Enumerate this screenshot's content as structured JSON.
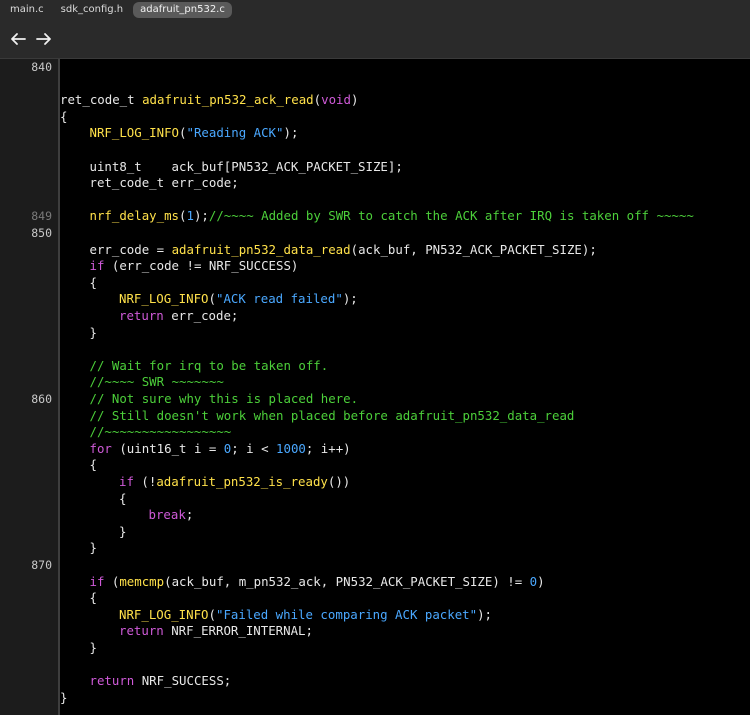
{
  "tabs": [
    {
      "label": "main.c",
      "active": false
    },
    {
      "label": "sdk_config.h",
      "active": false
    },
    {
      "label": "adafruit_pn532.c",
      "active": true
    }
  ],
  "nav": {
    "back_icon": "arrow-left-icon",
    "forward_icon": "arrow-right-icon"
  },
  "line_numbers": [
    {
      "text": "840",
      "row": 0,
      "style": "major"
    },
    {
      "text": "849",
      "row": 9,
      "style": "minor"
    },
    {
      "text": "850",
      "row": 10,
      "style": "major"
    },
    {
      "text": "860",
      "row": 20,
      "style": "major"
    },
    {
      "text": "870",
      "row": 30,
      "style": "major"
    }
  ],
  "colors": {
    "plain": "#e8e8e8",
    "keyword": "#cf5ad8",
    "function": "#ffe14a",
    "string": "#4aa8ff",
    "number": "#4aa8ff",
    "comment": "#4ccf3a"
  },
  "code_lines": [
    {
      "indent": 0,
      "tokens": []
    },
    {
      "indent": 0,
      "tokens": []
    },
    {
      "indent": 0,
      "tokens": [
        [
          "plain",
          "ret_code_t "
        ],
        [
          "fn",
          "adafruit_pn532_ack_read"
        ],
        [
          "plain",
          "("
        ],
        [
          "kw",
          "void"
        ],
        [
          "plain",
          ")"
        ]
      ]
    },
    {
      "indent": 0,
      "tokens": [
        [
          "plain",
          "{"
        ]
      ]
    },
    {
      "indent": 1,
      "tokens": [
        [
          "fn",
          "NRF_LOG_INFO"
        ],
        [
          "plain",
          "("
        ],
        [
          "str",
          "\"Reading ACK\""
        ],
        [
          "plain",
          ");"
        ]
      ]
    },
    {
      "indent": 0,
      "tokens": []
    },
    {
      "indent": 1,
      "tokens": [
        [
          "plain",
          "uint8_t    ack_buf[PN532_ACK_PACKET_SIZE];"
        ]
      ]
    },
    {
      "indent": 1,
      "tokens": [
        [
          "plain",
          "ret_code_t err_code;"
        ]
      ]
    },
    {
      "indent": 0,
      "tokens": []
    },
    {
      "indent": 1,
      "tokens": [
        [
          "fn",
          "nrf_delay_ms"
        ],
        [
          "plain",
          "("
        ],
        [
          "num",
          "1"
        ],
        [
          "plain",
          ");"
        ],
        [
          "cm",
          "//~~~~ Added by SWR to catch the ACK after IRQ is taken off ~~~~~"
        ]
      ]
    },
    {
      "indent": 0,
      "tokens": []
    },
    {
      "indent": 1,
      "tokens": [
        [
          "plain",
          "err_code = "
        ],
        [
          "fn",
          "adafruit_pn532_data_read"
        ],
        [
          "plain",
          "(ack_buf, PN532_ACK_PACKET_SIZE);"
        ]
      ]
    },
    {
      "indent": 1,
      "tokens": [
        [
          "kw",
          "if"
        ],
        [
          "plain",
          " (err_code != NRF_SUCCESS)"
        ]
      ]
    },
    {
      "indent": 1,
      "tokens": [
        [
          "plain",
          "{"
        ]
      ]
    },
    {
      "indent": 2,
      "tokens": [
        [
          "fn",
          "NRF_LOG_INFO"
        ],
        [
          "plain",
          "("
        ],
        [
          "str",
          "\"ACK read failed\""
        ],
        [
          "plain",
          ");"
        ]
      ]
    },
    {
      "indent": 2,
      "tokens": [
        [
          "kw",
          "return"
        ],
        [
          "plain",
          " err_code;"
        ]
      ]
    },
    {
      "indent": 1,
      "tokens": [
        [
          "plain",
          "}"
        ]
      ]
    },
    {
      "indent": 0,
      "tokens": []
    },
    {
      "indent": 1,
      "tokens": [
        [
          "cm",
          "// Wait for irq to be taken off."
        ]
      ]
    },
    {
      "indent": 1,
      "tokens": [
        [
          "cm",
          "//~~~~ SWR ~~~~~~~"
        ]
      ]
    },
    {
      "indent": 1,
      "tokens": [
        [
          "cm",
          "// Not sure why this is placed here."
        ]
      ]
    },
    {
      "indent": 1,
      "tokens": [
        [
          "cm",
          "// Still doesn't work when placed before adafruit_pn532_data_read"
        ]
      ]
    },
    {
      "indent": 1,
      "tokens": [
        [
          "cm",
          "//~~~~~~~~~~~~~~~~~"
        ]
      ]
    },
    {
      "indent": 1,
      "tokens": [
        [
          "kw",
          "for"
        ],
        [
          "plain",
          " (uint16_t i = "
        ],
        [
          "num",
          "0"
        ],
        [
          "plain",
          "; i < "
        ],
        [
          "num",
          "1000"
        ],
        [
          "plain",
          "; i++)"
        ]
      ]
    },
    {
      "indent": 1,
      "tokens": [
        [
          "plain",
          "{"
        ]
      ]
    },
    {
      "indent": 2,
      "tokens": [
        [
          "kw",
          "if"
        ],
        [
          "plain",
          " (!"
        ],
        [
          "fn",
          "adafruit_pn532_is_ready"
        ],
        [
          "plain",
          "())"
        ]
      ]
    },
    {
      "indent": 2,
      "tokens": [
        [
          "plain",
          "{"
        ]
      ]
    },
    {
      "indent": 3,
      "tokens": [
        [
          "kw",
          "break"
        ],
        [
          "plain",
          ";"
        ]
      ]
    },
    {
      "indent": 2,
      "tokens": [
        [
          "plain",
          "}"
        ]
      ]
    },
    {
      "indent": 1,
      "tokens": [
        [
          "plain",
          "}"
        ]
      ]
    },
    {
      "indent": 0,
      "tokens": []
    },
    {
      "indent": 1,
      "tokens": [
        [
          "kw",
          "if"
        ],
        [
          "plain",
          " ("
        ],
        [
          "fn",
          "memcmp"
        ],
        [
          "plain",
          "(ack_buf, m_pn532_ack, PN532_ACK_PACKET_SIZE) != "
        ],
        [
          "num",
          "0"
        ],
        [
          "plain",
          ")"
        ]
      ]
    },
    {
      "indent": 1,
      "tokens": [
        [
          "plain",
          "{"
        ]
      ]
    },
    {
      "indent": 2,
      "tokens": [
        [
          "fn",
          "NRF_LOG_INFO"
        ],
        [
          "plain",
          "("
        ],
        [
          "str",
          "\"Failed while comparing ACK packet\""
        ],
        [
          "plain",
          ");"
        ]
      ]
    },
    {
      "indent": 2,
      "tokens": [
        [
          "kw",
          "return"
        ],
        [
          "plain",
          " NRF_ERROR_INTERNAL;"
        ]
      ]
    },
    {
      "indent": 1,
      "tokens": [
        [
          "plain",
          "}"
        ]
      ]
    },
    {
      "indent": 0,
      "tokens": []
    },
    {
      "indent": 1,
      "tokens": [
        [
          "kw",
          "return"
        ],
        [
          "plain",
          " NRF_SUCCESS;"
        ]
      ]
    },
    {
      "indent": 0,
      "tokens": [
        [
          "plain",
          "}"
        ]
      ]
    }
  ]
}
